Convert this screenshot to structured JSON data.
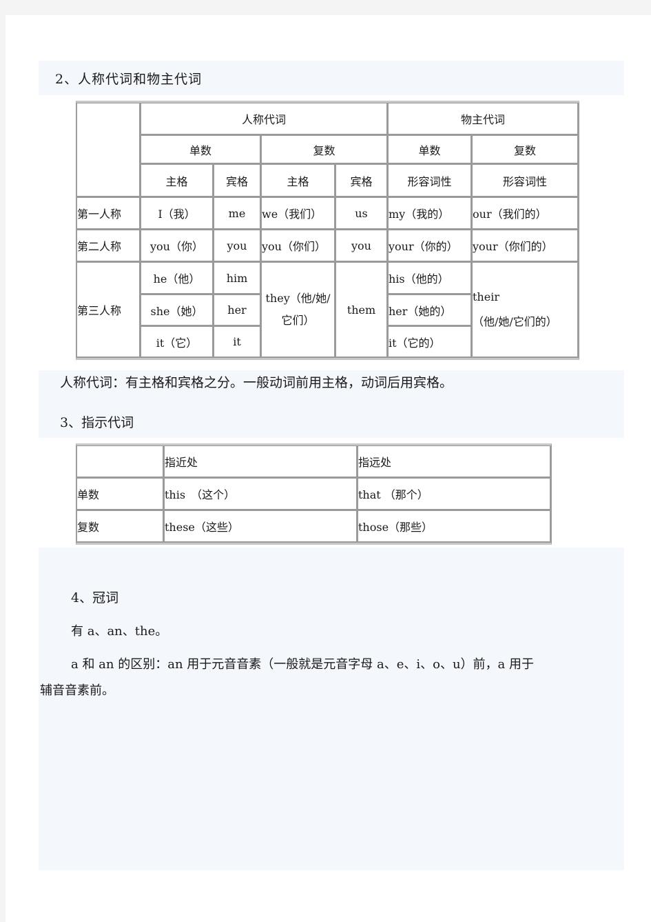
{
  "section2": {
    "heading": "2、人称代词和物主代词",
    "table": {
      "group_headers": [
        "人称代词",
        "物主代词"
      ],
      "number_headers": [
        "单数",
        "复数",
        "单数",
        "复数"
      ],
      "case_headers": [
        "主格",
        "宾格",
        "主格",
        "宾格",
        "形容词性",
        "形容词性"
      ],
      "rows": [
        {
          "person": "第一人称",
          "sg_subj": "I（我）",
          "sg_obj": "me",
          "pl_subj": "we（我们）",
          "pl_obj": "us",
          "poss_sg": "my（我的）",
          "poss_pl": "our（我们的）"
        },
        {
          "person": "第二人称",
          "sg_subj": "you（你）",
          "sg_obj": "you",
          "pl_subj": "you（你们）",
          "pl_obj": "you",
          "poss_sg": "your（你的）",
          "poss_pl": "your（你们的）"
        }
      ],
      "third": {
        "person": "第三人称",
        "sg_subj": [
          "he（他）",
          "she（她）",
          "it（它）"
        ],
        "sg_obj": [
          "him",
          "her",
          "it"
        ],
        "pl_subj": "they（他/她/它们）",
        "pl_obj": "them",
        "poss_sg": [
          "his（他的）",
          "her（她的）",
          "it（它的）"
        ],
        "poss_pl_line1": "their",
        "poss_pl_line2": "（他/她/它们的）"
      }
    },
    "note": "人称代词：有主格和宾格之分。一般动词前用主格，动词后用宾格。"
  },
  "section3": {
    "heading": "3、指示代词",
    "table": {
      "headers": [
        "",
        "指近处",
        "指远处"
      ],
      "rows": [
        [
          "单数",
          "this　（这个）",
          "that （那个）"
        ],
        [
          "复数",
          "these（这些）",
          "those（那些）"
        ]
      ]
    }
  },
  "section4": {
    "heading": "4、冠词",
    "line1": "有 a、an、the。",
    "line2_first": "a 和 an 的区别：an 用于元音音素（一般就是元音字母 a、e、i、o、u）前，a 用于",
    "line2_cont": "辅音音素前。"
  }
}
